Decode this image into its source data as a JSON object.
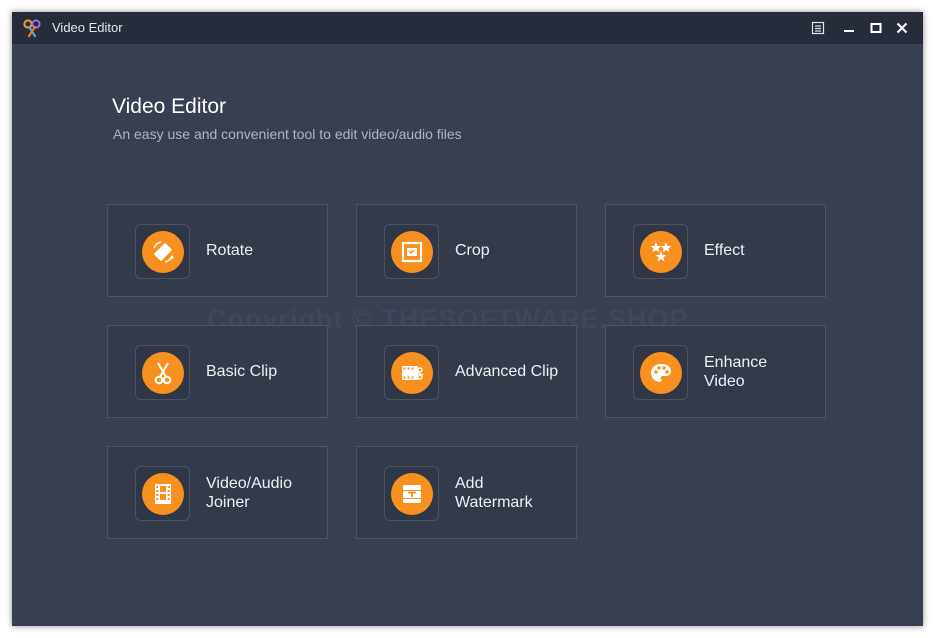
{
  "window": {
    "title": "Video Editor",
    "controls": {
      "menu_icon": "menu-list-icon",
      "minimize_icon": "minimize-icon",
      "maximize_icon": "maximize-icon",
      "close_icon": "close-icon"
    }
  },
  "main": {
    "heading": "Video Editor",
    "subheading": "An easy use and convenient tool to edit video/audio files",
    "watermark": "Copyright © THESOFTWARE.SHOP",
    "tools": [
      {
        "label": "Rotate",
        "icon": "rotate-icon"
      },
      {
        "label": "Crop",
        "icon": "crop-icon"
      },
      {
        "label": "Effect",
        "icon": "effect-stars-icon"
      },
      {
        "label": "Basic Clip",
        "icon": "scissors-icon"
      },
      {
        "label": "Advanced Clip",
        "icon": "film-clip-icon"
      },
      {
        "label": "Enhance\nVideo",
        "icon": "palette-icon"
      },
      {
        "label": "Video/Audio\nJoiner",
        "icon": "film-strip-icon"
      },
      {
        "label": "Add\nWatermark",
        "icon": "watermark-stamp-icon"
      }
    ]
  },
  "colors": {
    "background": "#373f51",
    "titlebar": "#262c3a",
    "tile": "#333a4a",
    "tile_border": "#4c5468",
    "accent": "#f7901e"
  }
}
